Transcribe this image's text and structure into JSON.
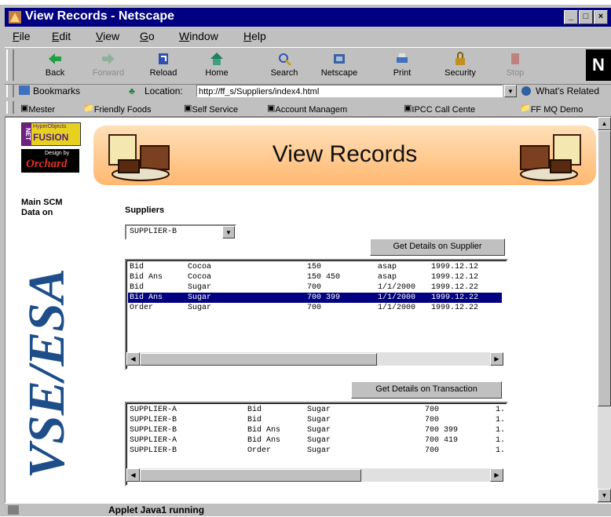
{
  "window": {
    "title": "View Records - Netscape"
  },
  "menu": [
    "File",
    "Edit",
    "View",
    "Go",
    "Window",
    "Help"
  ],
  "toolbar": {
    "buttons": [
      {
        "label": "Back",
        "icon": "back-arrow-icon",
        "enabled": true
      },
      {
        "label": "Forward",
        "icon": "forward-arrow-icon",
        "enabled": false
      },
      {
        "label": "Reload",
        "icon": "reload-icon",
        "enabled": true
      },
      {
        "label": "Home",
        "icon": "home-icon",
        "enabled": true
      },
      {
        "label": "Search",
        "icon": "search-icon",
        "enabled": true
      },
      {
        "label": "Netscape",
        "icon": "netscape-icon",
        "enabled": true
      },
      {
        "label": "Print",
        "icon": "print-icon",
        "enabled": true
      },
      {
        "label": "Security",
        "icon": "security-lock-icon",
        "enabled": true
      },
      {
        "label": "Stop",
        "icon": "stop-icon",
        "enabled": false
      }
    ]
  },
  "location": {
    "bookmarks_label": "Bookmarks",
    "location_label": "Location:",
    "url": "http://ff_s/Suppliers/index4.html",
    "whats_related": "What's Related"
  },
  "personal_toolbar": [
    "Mester",
    "Friendly Foods",
    "Self Service",
    "Account Managem",
    "IPCC Call Cente",
    "FF MQ Demo"
  ],
  "page": {
    "logo_top": "FUSION",
    "logo_top_small": "HyperObjects",
    "logo_top_side": "NET",
    "logo_bottom": "Orchard",
    "logo_bottom_small": "Design by",
    "banner_title": "View Records",
    "side_text": "Main SCM Data on",
    "vertical_brand": "VSE/ESA",
    "suppliers_label": "Suppliers",
    "supplier_select": "SUPPLIER-B",
    "btn_supplier": "Get Details on Supplier",
    "btn_transaction": "Get Details on Transaction"
  },
  "records": [
    {
      "type": "Bid",
      "item": "Cocoa",
      "qty": "150",
      "date1": "asap",
      "date2": "1999.12.12",
      "selected": false
    },
    {
      "type": "Bid Ans",
      "item": "Cocoa",
      "qty": "150 450",
      "date1": "asap",
      "date2": "1999.12.12",
      "selected": false
    },
    {
      "type": "Bid",
      "item": "Sugar",
      "qty": "700",
      "date1": "1/1/2000",
      "date2": "1999.12.22",
      "selected": false
    },
    {
      "type": "Bid Ans",
      "item": "Sugar",
      "qty": "700 399",
      "date1": "1/1/2000",
      "date2": "1999.12.22",
      "selected": true
    },
    {
      "type": "Order",
      "item": "Sugar",
      "qty": "700",
      "date1": "1/1/2000",
      "date2": "1999.12.22",
      "selected": false
    }
  ],
  "transactions": [
    {
      "supplier": "SUPPLIER-A",
      "type": "Bid",
      "item": "Sugar",
      "qty": "700",
      "tail": "1."
    },
    {
      "supplier": "SUPPLIER-B",
      "type": "Bid",
      "item": "Sugar",
      "qty": "700",
      "tail": "1."
    },
    {
      "supplier": "SUPPLIER-B",
      "type": "Bid Ans",
      "item": "Sugar",
      "qty": "700 399",
      "tail": "1."
    },
    {
      "supplier": "SUPPLIER-A",
      "type": "Bid Ans",
      "item": "Sugar",
      "qty": "700 419",
      "tail": "1."
    },
    {
      "supplier": "SUPPLIER-B",
      "type": "Order",
      "item": "Sugar",
      "qty": "700",
      "tail": "1."
    }
  ],
  "status": {
    "text": "Applet Java1 running"
  },
  "colors": {
    "titlebar": "#000080",
    "selection": "#000080",
    "banner": "#ffb870"
  }
}
